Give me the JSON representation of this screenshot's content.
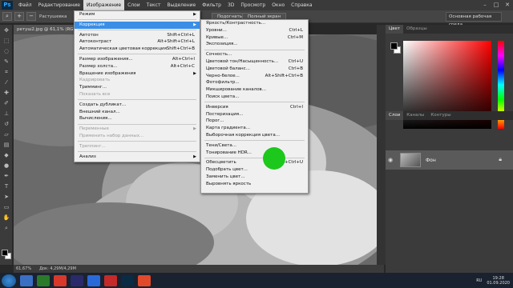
{
  "app": {
    "logo_text": "Ps"
  },
  "menubar": [
    "Файл",
    "Редактирование",
    "Изображение",
    "Слои",
    "Текст",
    "Выделение",
    "Фильтр",
    "3D",
    "Просмотр",
    "Окно",
    "Справка"
  ],
  "options_bar": {
    "feather_label": "Растушевка",
    "fit_button": "Подогнать",
    "fullscreen_button": "Полный экран",
    "workspace": "Основная рабочая среда"
  },
  "document": {
    "tab_title": "ретуш2.jpg @ 61,1% (RGB/8*)",
    "zoom": "61,67%",
    "doc_size": "Док: 4,29М/4,29М"
  },
  "image_menu": [
    {
      "label": "Режим",
      "arrow": true
    },
    {
      "sep": true
    },
    {
      "label": "Коррекция",
      "arrow": true,
      "highlight": true
    },
    {
      "sep": true
    },
    {
      "label": "Автотон",
      "shortcut": "Shift+Ctrl+L"
    },
    {
      "label": "Автоконтраст",
      "shortcut": "Alt+Shift+Ctrl+L"
    },
    {
      "label": "Автоматическая цветовая коррекция",
      "shortcut": "Shift+Ctrl+B"
    },
    {
      "sep": true
    },
    {
      "label": "Размер изображения...",
      "shortcut": "Alt+Ctrl+I"
    },
    {
      "label": "Размер холста...",
      "shortcut": "Alt+Ctrl+C"
    },
    {
      "label": "Вращение изображения",
      "arrow": true
    },
    {
      "label": "Кадрировать",
      "disabled": true
    },
    {
      "label": "Тримминг..."
    },
    {
      "label": "Показать все",
      "disabled": true
    },
    {
      "sep": true
    },
    {
      "label": "Создать дубликат..."
    },
    {
      "label": "Внешний канал..."
    },
    {
      "label": "Вычисления..."
    },
    {
      "sep": true
    },
    {
      "label": "Переменные",
      "arrow": true,
      "disabled": true
    },
    {
      "label": "Применить набор данных...",
      "disabled": true
    },
    {
      "sep": true
    },
    {
      "label": "Треппинг...",
      "disabled": true
    },
    {
      "sep": true
    },
    {
      "label": "Анализ",
      "arrow": true
    }
  ],
  "adjustments_menu": [
    {
      "label": "Яркость/Контрастность..."
    },
    {
      "label": "Уровни...",
      "shortcut": "Ctrl+L"
    },
    {
      "label": "Кривые...",
      "shortcut": "Ctrl+M"
    },
    {
      "label": "Экспозиция..."
    },
    {
      "sep": true
    },
    {
      "label": "Сочность..."
    },
    {
      "label": "Цветовой тон/Насыщенность...",
      "shortcut": "Ctrl+U"
    },
    {
      "label": "Цветовой баланс...",
      "shortcut": "Ctrl+B"
    },
    {
      "label": "Черно-белое...",
      "shortcut": "Alt+Shift+Ctrl+B"
    },
    {
      "label": "Фотофильтр..."
    },
    {
      "label": "Микширование каналов..."
    },
    {
      "label": "Поиск цвета..."
    },
    {
      "sep": true
    },
    {
      "label": "Инверсия",
      "shortcut": "Ctrl+I"
    },
    {
      "label": "Постеризация..."
    },
    {
      "label": "Порог..."
    },
    {
      "label": "Карта градиента..."
    },
    {
      "label": "Выборочная коррекция цвета..."
    },
    {
      "sep": true
    },
    {
      "label": "Тени/Света..."
    },
    {
      "label": "Тонирование HDR..."
    },
    {
      "sep": true
    },
    {
      "label": "Обесцветить",
      "shortcut": "Shift+Ctrl+U"
    },
    {
      "label": "Подобрать цвет..."
    },
    {
      "label": "Заменить цвет..."
    },
    {
      "label": "Выровнять яркость"
    }
  ],
  "panels": {
    "color_tabs": [
      "Цвет",
      "Образцы"
    ],
    "layer_tabs": [
      "Слои",
      "Каналы",
      "Контуры"
    ],
    "layer_name": "Фон"
  },
  "taskbar": {
    "lang": "RU",
    "time": "19:28",
    "date": "01.09.2020"
  },
  "colors": {
    "accent": "#3a8ee6",
    "cursor": "#1cc81c"
  }
}
